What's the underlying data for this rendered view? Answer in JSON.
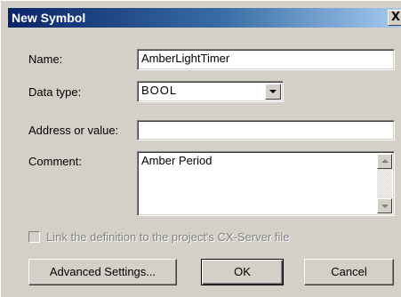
{
  "dialog": {
    "title": "New Symbol",
    "close_glyph": "X"
  },
  "form": {
    "name_label": "Name:",
    "name_value": "AmberLightTimer",
    "datatype_label": "Data type:",
    "datatype_value": "BOOL",
    "address_label": "Address or value:",
    "address_value": "",
    "comment_label": "Comment:",
    "comment_value": "Amber Period"
  },
  "checkbox": {
    "label": "Link the definition to the project's CX-Server file",
    "checked": false,
    "enabled": false
  },
  "buttons": {
    "advanced": "Advanced Settings...",
    "ok": "OK",
    "cancel": "Cancel"
  },
  "icons": {
    "close": "close-icon",
    "combo": "chevron-down-icon",
    "scroll_up": "scroll-up-icon",
    "scroll_down": "scroll-down-icon"
  },
  "colors": {
    "title_start": "#0a246a",
    "title_end": "#a6caf0",
    "face": "#d4d0c8"
  }
}
